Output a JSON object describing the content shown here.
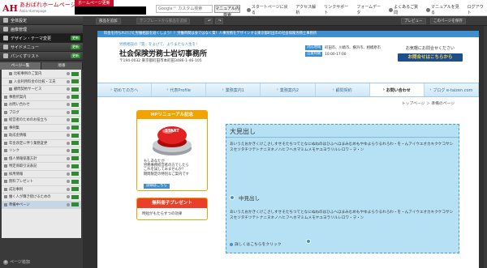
{
  "topbar": {
    "logo_mark": "AH",
    "logo_title": "あおばれホームページ",
    "logo_sub": "Aoba Homepage",
    "hp_badge": "ホームページ更新",
    "search_placeholder": "Google™ カスタム検索",
    "search_button": "マニュアル内検索",
    "nav": [
      "スタートページに戻る",
      "アクセス解析",
      "リンクサポート",
      "フォームデータ",
      "よくあるご質問",
      "マニュアルを見る",
      "ログアウト"
    ]
  },
  "sidebar": {
    "menu": [
      {
        "label": "全体設定",
        "badge": ""
      },
      {
        "label": "画像管理",
        "badge": ""
      },
      {
        "label": "デザイン・テーマ変更",
        "badge": "更新"
      },
      {
        "label": "サイドメニュー",
        "badge": "更新"
      },
      {
        "label": "パンくずリスト",
        "badge": "更新"
      }
    ],
    "tabs": [
      "ページ一覧",
      "順番"
    ],
    "pages": [
      {
        "label": "比較事例のご案内",
        "sub": true
      },
      {
        "label": "入会利用料金の比較・工夫",
        "sub": true
      },
      {
        "label": "顧問契約サービス",
        "sub": true
      },
      {
        "label": "事務所案内",
        "sub": false
      },
      {
        "label": "お問い合わせ",
        "sub": false
      },
      {
        "label": "ブログ",
        "sub": false
      },
      {
        "label": "経営者のためのお役立ち",
        "sub": false
      },
      {
        "label": "事例集",
        "sub": false
      },
      {
        "label": "助成金情報",
        "sub": false
      },
      {
        "label": "年金改定に伴う業務変更",
        "sub": false
      },
      {
        "label": "リンク",
        "sub": false
      },
      {
        "label": "個人情報保護方針",
        "sub": false
      },
      {
        "label": "特定商取引法表記",
        "sub": false
      },
      {
        "label": "採用情報",
        "sub": false
      },
      {
        "label": "無料プレゼント",
        "sub": false
      },
      {
        "label": "成功事例",
        "sub": false
      },
      {
        "label": "働く人が輝き続けるための",
        "sub": false
      },
      {
        "label": "準備中ページ",
        "sub": false
      }
    ],
    "add_page": "ページ追加"
  },
  "toolbar": {
    "insert": "部品を追加",
    "template": "テンプレートから部品を追加",
    "preview": "プレビュー",
    "publish": "このページを保存"
  },
  "site": {
    "topline": "料金を持ちれけけた労働相談を短くしよう！！労働時間は身ではなく質！人事労務をデザインする東京都町田市の社会保険労務士事務所",
    "catch": "労務相談の『質』をよげて、よりまたな人生を！",
    "office": "社会保険労務士岩切事務所",
    "address": "〒194-0032 東京都町田市本町田3486-1-46-105",
    "info": [
      {
        "label": "対応地域",
        "value": "町田市、川崎市、横浜市、相模原市"
      },
      {
        "label": "営業時間",
        "value": "10:00-17:00"
      }
    ],
    "contact_text": "お気軽にお問合せください",
    "contact_button": "お問合せはこちらから",
    "gnav": [
      "初めての方へ",
      "代表Profile",
      "業務案内1",
      "業務案内2",
      "顧問契約",
      "お問い合わせ",
      "ブログ e-taizen.com"
    ],
    "breadcrumb": "トップページ ＞ 準備のページ",
    "renewal_title": "HPリニューアル記念",
    "start_label": "START",
    "renewal_text": [
      "もしあなたが",
      "労務事務経営者の方でしたら",
      "これを試してみませんか？",
      "期間限定の特別なご案内です"
    ],
    "renewal_link": "詳細はこちら",
    "present_title": "無料冊子プレゼント",
    "present_text": "時短がもたらすつの効果",
    "h_big": "大見出し",
    "para1": "あいうえおかきくけこさしすせそたちつてとなにぬねのはひふへほまみむめもやゆよらりるれろわ・を・んアイウエオカキクケコサシスセソタチツテトナニヌネノハヒフヘホマミムメモヤユヨラリルレロワ・ヲ・ン",
    "h_mid": "中見出し",
    "para2": "あいうえおかきくけこさしすせそたちつてとなにぬねのはひふへほまみむめもやゆよらりるれろわ・を・んアイウエオカキクケコサシスセソタチツテトナニヌネノハヒフヘホマミムメモヤユヨラリルレロワ・ヲ・ン",
    "more_link": "詳しくはこちらをクリック"
  },
  "colors": {
    "accent_blue": "#3d8fd0",
    "brand_red": "#b8001f",
    "content_bg": "#b6e1f5",
    "orange": "#f3a300"
  }
}
